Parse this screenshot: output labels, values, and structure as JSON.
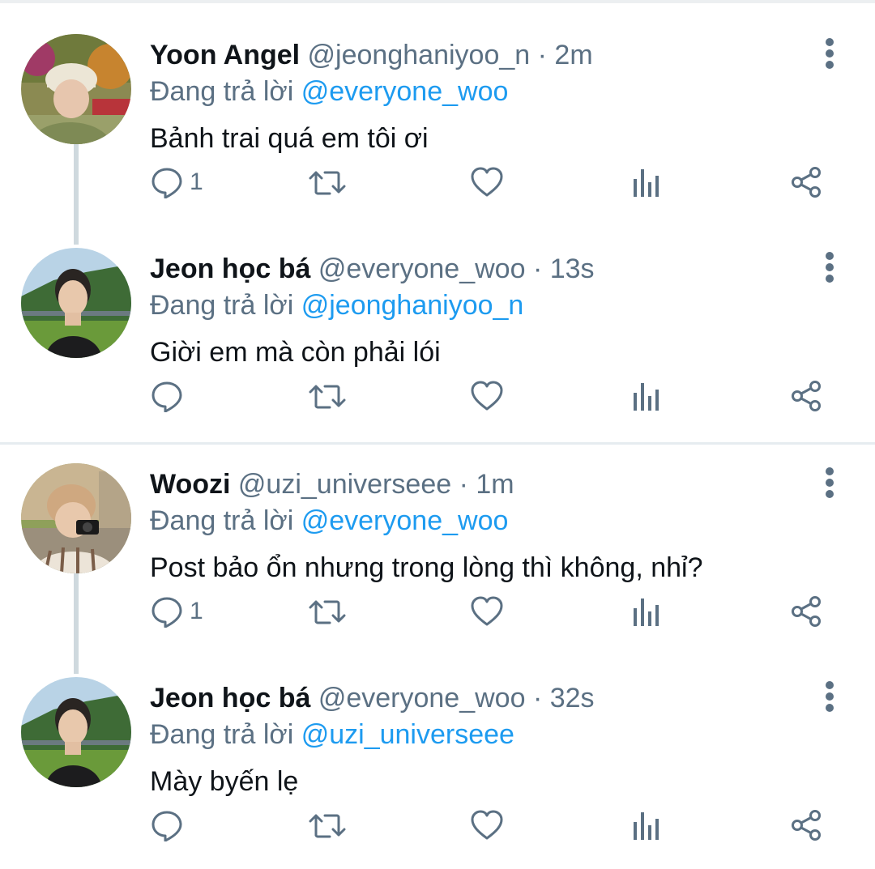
{
  "replying_label": "Đang trả lời",
  "colors": {
    "name": "#0f1419",
    "secondary": "#5b7083",
    "mention": "#1d9bf0",
    "divider": "#e6ecf0"
  },
  "tweets": [
    {
      "name": "Yoon Angel",
      "handle": "@jeonghaniyoo_n",
      "separator": "·",
      "time": "2m",
      "replying_to": "@everyone_woo",
      "text": "Bảnh trai quá em tôi ơi",
      "reply_count": "1",
      "avatar_icon": "avatar-bucket-hat-photo"
    },
    {
      "name": "Jeon học bá",
      "handle": "@everyone_woo",
      "separator": "·",
      "time": "13s",
      "replying_to": "@jeonghaniyoo_n",
      "text": "Giời em mà còn phải lói",
      "reply_count": "",
      "avatar_icon": "avatar-landscape-photo"
    },
    {
      "name": "Woozi",
      "handle": "@uzi_universeee",
      "separator": "·",
      "time": "1m",
      "replying_to": "@everyone_woo",
      "text": "Post bảo ổn nhưng trong lòng thì không, nhỉ?",
      "reply_count": "1",
      "avatar_icon": "avatar-camera-photo"
    },
    {
      "name": "Jeon học bá",
      "handle": "@everyone_woo",
      "separator": "·",
      "time": "32s",
      "replying_to": "@uzi_universeee",
      "text": "Mày byến lẹ",
      "reply_count": "",
      "avatar_icon": "avatar-landscape-photo"
    }
  ]
}
